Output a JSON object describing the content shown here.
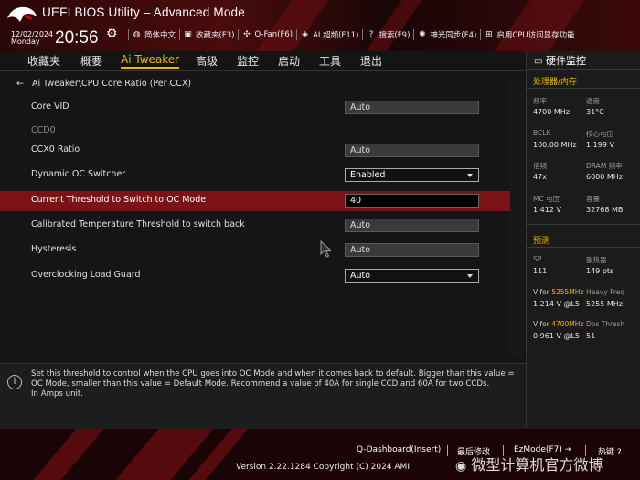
{
  "header": {
    "title": "UEFI BIOS Utility – Advanced Mode",
    "date": "12/02/2024",
    "day": "Monday",
    "time": "20:56",
    "toolbar": [
      {
        "icon": "globe-icon",
        "label": "简体中文"
      },
      {
        "icon": "favorites-icon",
        "label": "收藏夹(F3)"
      },
      {
        "icon": "fan-icon",
        "label": "Q-Fan(F6)"
      },
      {
        "icon": "ai-overclock-icon",
        "label": "AI 超频(F11)"
      },
      {
        "icon": "help-icon",
        "label": "搜索(F9)"
      },
      {
        "icon": "aura-light-icon",
        "label": "神光同步(F4)"
      },
      {
        "icon": "memory-icon",
        "label": "启用CPU访问显存功能"
      }
    ]
  },
  "nav": {
    "tabs": [
      "收藏夹",
      "概要",
      "Ai Tweaker",
      "高级",
      "监控",
      "启动",
      "工具",
      "退出"
    ],
    "active": "Ai Tweaker"
  },
  "breadcrumb": "Ai Tweaker\\CPU Core Ratio (Per CCX)",
  "settings": [
    {
      "label": "Core VID",
      "value": "Auto",
      "kind": "field"
    },
    {
      "label": "CCD0",
      "value": "",
      "kind": "section"
    },
    {
      "label": "CCX0 Ratio",
      "value": "Auto",
      "kind": "field"
    },
    {
      "label": "Dynamic OC Switcher",
      "value": "Enabled",
      "kind": "dropdown"
    },
    {
      "label": "Current Threshold to Switch to OC Mode",
      "value": "40",
      "kind": "input",
      "selected": true
    },
    {
      "label": "Calibrated Temperature Threshold to switch back",
      "value": "Auto",
      "kind": "field"
    },
    {
      "label": "Hysteresis",
      "value": "Auto",
      "kind": "field"
    },
    {
      "label": "Overclocking Load Guard",
      "value": "Auto",
      "kind": "dropdown"
    }
  ],
  "help_text": "Set this threshold to control when the CPU goes into OC Mode and when it comes back to default. Bigger than this value = OC Mode, smaller than this value = Default Mode. Recommend a value of 40A for single CCD and 60A for two CCDs.\nIn Amps unit.",
  "hw_monitor": {
    "title": "硬件监控",
    "cpu_section": "处理器/内存",
    "items": [
      {
        "label": "频率",
        "value": "4700 MHz"
      },
      {
        "label": "温度",
        "value": "31°C"
      },
      {
        "label": "BCLK",
        "value": "100.00 MHz"
      },
      {
        "label": "核心电压",
        "value": "1.199 V"
      },
      {
        "label": "倍频",
        "value": "47x"
      },
      {
        "label": "DRAM 频率",
        "value": "6000 MHz"
      },
      {
        "label": "MC 电压",
        "value": "1.412 V"
      },
      {
        "label": "容量",
        "value": "32768 MB"
      }
    ],
    "predict_section": "预测",
    "predict": {
      "sp_label": "SP",
      "sp_value": "111",
      "cooler_label": "散热器",
      "cooler_value": "149 pts",
      "v1_prefix": "V for",
      "v1_freq": "5255MHz",
      "v1_label": "Heavy Freq",
      "v1_value": "1.214 V @L5",
      "v1_result": "5255 MHz",
      "v2_prefix": "V for",
      "v2_freq": "4700MHz",
      "v2_label": "Dos Thresh",
      "v2_value": "0.961 V @L5",
      "v2_result": "51"
    }
  },
  "footer": {
    "qdashboard": "Q-Dashboard(Insert)",
    "last_modified": "最后修改",
    "ezmode": "EzMode(F7)",
    "hotkeys": "热键",
    "version": "Version 2.22.1284 Copyright (C) 2024 AMI"
  },
  "watermark": "微型计算机官方微博",
  "colors": {
    "accent": "#e6b800",
    "selected_row": "#7a1216",
    "header_red": "#4a0b0d"
  }
}
